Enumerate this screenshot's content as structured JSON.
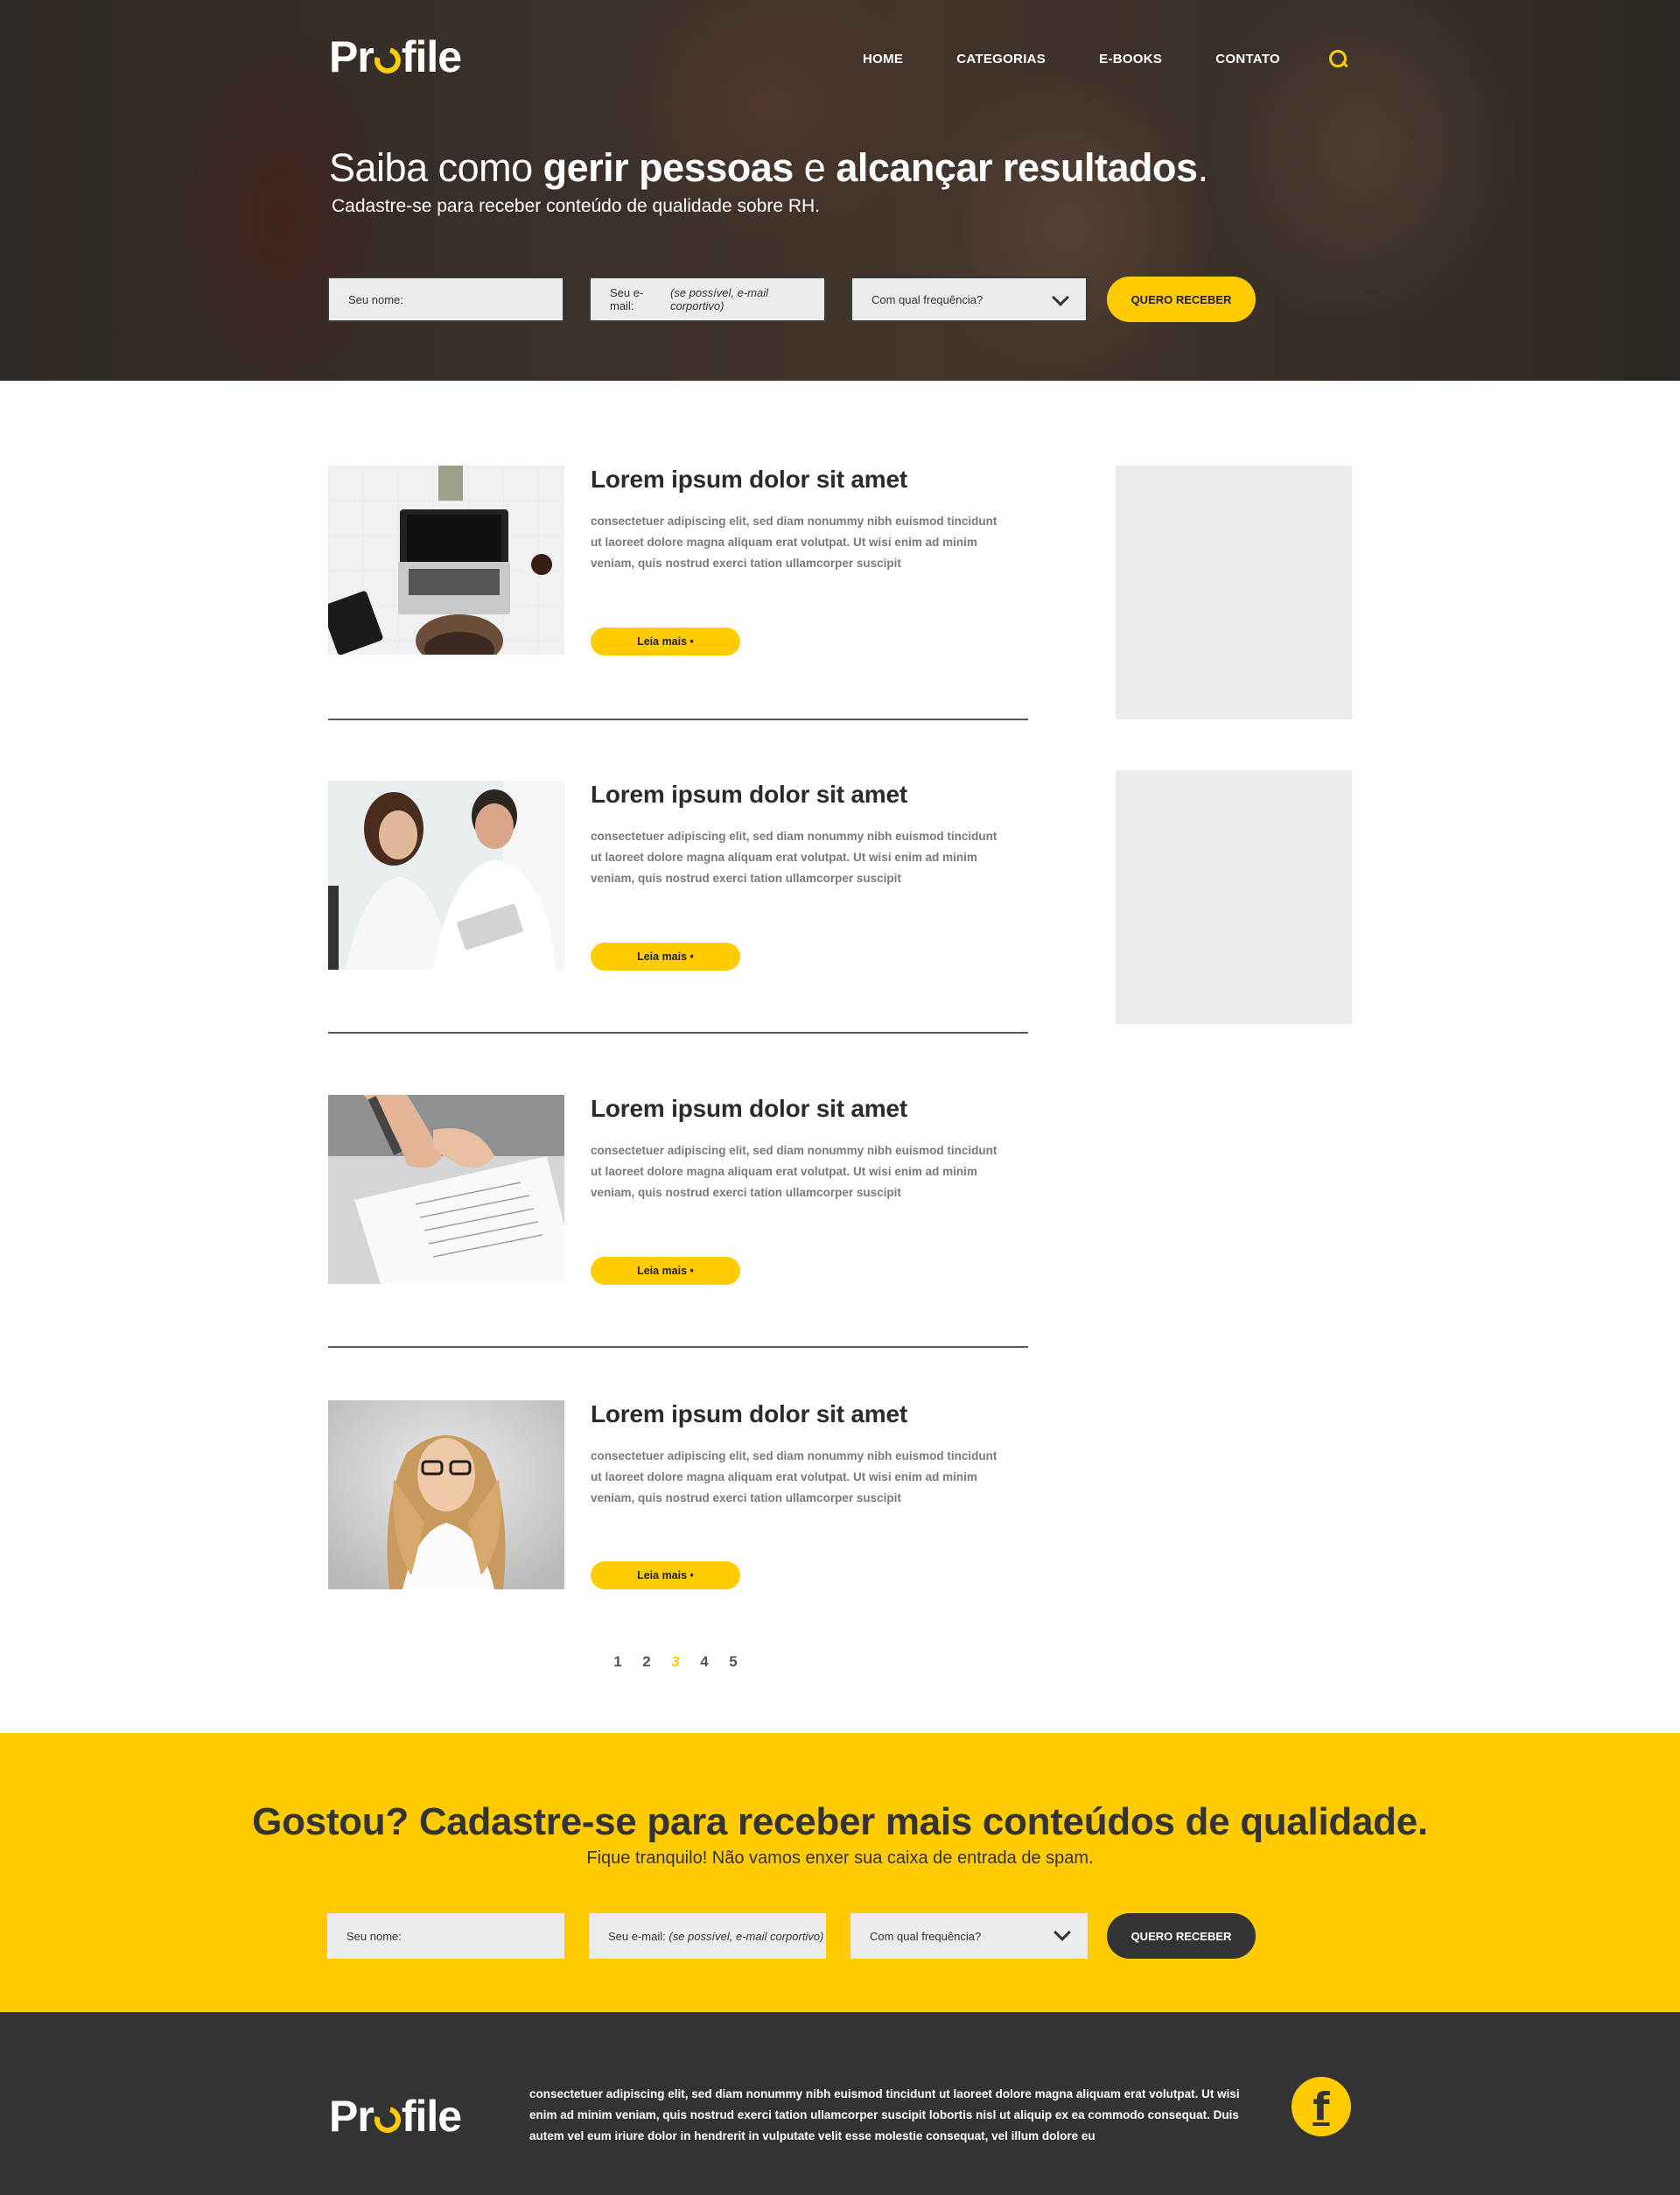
{
  "brand": {
    "logo_text_pre": "Pr",
    "logo_text_post": "file",
    "accent_color": "#ffcc00",
    "dark_color": "#333333"
  },
  "nav": {
    "items": [
      {
        "label": "HOME"
      },
      {
        "label": "CATEGORIAS"
      },
      {
        "label": "E-BOOKS"
      },
      {
        "label": "CONTATO"
      }
    ],
    "search_icon": "search-icon"
  },
  "hero": {
    "title_1": "Saiba como ",
    "title_2": "gerir pessoas",
    "title_3": " e ",
    "title_4": "alcançar resultados",
    "title_5": ".",
    "subtitle": "Cadastre-se para receber conteúdo de qualidade sobre RH."
  },
  "form": {
    "name_placeholder": "Seu nome:",
    "email_placeholder_1": "Seu e-mail: ",
    "email_placeholder_2": "(se possível, e-mail corportivo)",
    "frequency_placeholder": "Com qual frequência?",
    "submit_label": "QUERO RECEBER"
  },
  "posts": [
    {
      "title": "Lorem ipsum dolor sit amet",
      "excerpt": "consectetuer adipiscing elit, sed diam nonummy nibh euismod tincidunt ut laoreet dolore magna aliquam erat volutpat. Ut wisi enim ad minim veniam, quis nostrud exerci tation ullamcorper suscipit",
      "cta": "Leia mais •",
      "image": "laptop-desk-photo"
    },
    {
      "title": "Lorem ipsum dolor sit amet",
      "excerpt": "consectetuer adipiscing elit, sed diam nonummy nibh euismod tincidunt ut laoreet dolore magna aliquam erat volutpat. Ut wisi enim ad minim veniam, quis nostrud exerci tation ullamcorper suscipit",
      "cta": "Leia mais •",
      "image": "colleagues-tablet-photo"
    },
    {
      "title": "Lorem ipsum dolor sit amet",
      "excerpt": "consectetuer adipiscing elit, sed diam nonummy nibh euismod tincidunt ut laoreet dolore magna aliquam erat volutpat. Ut wisi enim ad minim veniam, quis nostrud exerci tation ullamcorper suscipit",
      "cta": "Leia mais •",
      "image": "signing-document-photo"
    },
    {
      "title": "Lorem ipsum dolor sit amet",
      "excerpt": "consectetuer adipiscing elit, sed diam nonummy nibh euismod tincidunt ut laoreet dolore magna aliquam erat volutpat. Ut wisi enim ad minim veniam, quis nostrud exerci tation ullamcorper suscipit",
      "cta": "Leia mais •",
      "image": "woman-glasses-portrait-photo"
    }
  ],
  "pagination": {
    "pages": [
      "1",
      "2",
      "3",
      "4",
      "5"
    ],
    "current": "3"
  },
  "cta_band": {
    "title": "Gostou? Cadastre-se para receber mais conteúdos de qualidade.",
    "subtitle": "Fique tranquilo! Não vamos enxer sua caixa de entrada de spam."
  },
  "footer": {
    "text": "consectetuer adipiscing elit, sed diam nonummy nibh euismod tincidunt ut laoreet dolore magna aliquam erat volutpat. Ut wisi enim ad minim veniam, quis nostrud exerci tation ullamcorper suscipit lobortis nisl ut aliquip ex ea commodo consequat. Duis autem vel eum iriure dolor in hendrerit in vulputate velit esse molestie consequat, vel illum dolore eu",
    "facebook_icon": "facebook-icon",
    "facebook_glyph": "f"
  }
}
